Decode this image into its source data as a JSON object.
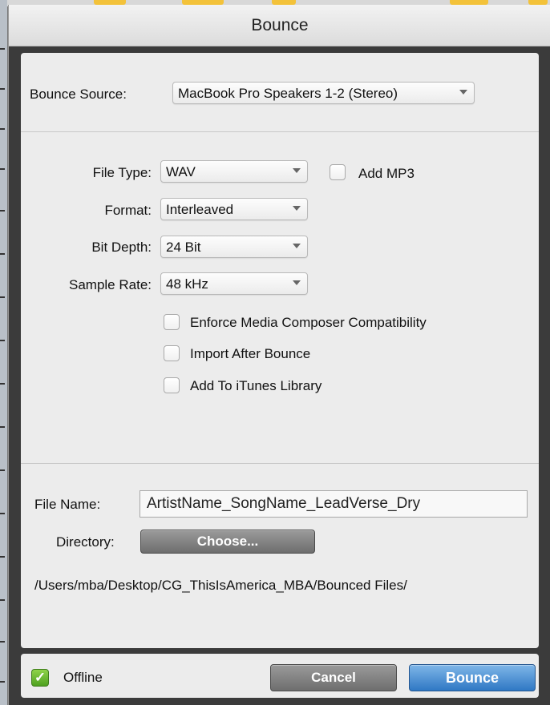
{
  "window": {
    "title": "Bounce"
  },
  "bounce_source": {
    "label": "Bounce Source:",
    "value": "MacBook Pro Speakers 1-2 (Stereo)"
  },
  "file_type": {
    "label": "File Type:",
    "value": "WAV",
    "add_mp3_label": "Add MP3",
    "add_mp3_checked": false
  },
  "format": {
    "label": "Format:",
    "value": "Interleaved"
  },
  "bit_depth": {
    "label": "Bit Depth:",
    "value": "24 Bit"
  },
  "sample_rate": {
    "label": "Sample Rate:",
    "value": "48 kHz"
  },
  "options": [
    {
      "label": "Enforce Media Composer Compatibility",
      "checked": false
    },
    {
      "label": "Import After Bounce",
      "checked": false
    },
    {
      "label": "Add To iTunes Library",
      "checked": false
    }
  ],
  "file_name": {
    "label": "File Name:",
    "value": "ArtistName_SongName_LeadVerse_Dry"
  },
  "directory": {
    "label": "Directory:",
    "button_label": "Choose...",
    "path": "/Users/mba/Desktop/CG_ThisIsAmerica_MBA/Bounced Files/"
  },
  "footer": {
    "offline_label": "Offline",
    "offline_checked": true,
    "cancel_label": "Cancel",
    "bounce_label": "Bounce"
  },
  "colors": {
    "accent_blue": "#2f78c4",
    "offline_green": "#5cb82a",
    "frame_dark": "#3b3b3b"
  }
}
